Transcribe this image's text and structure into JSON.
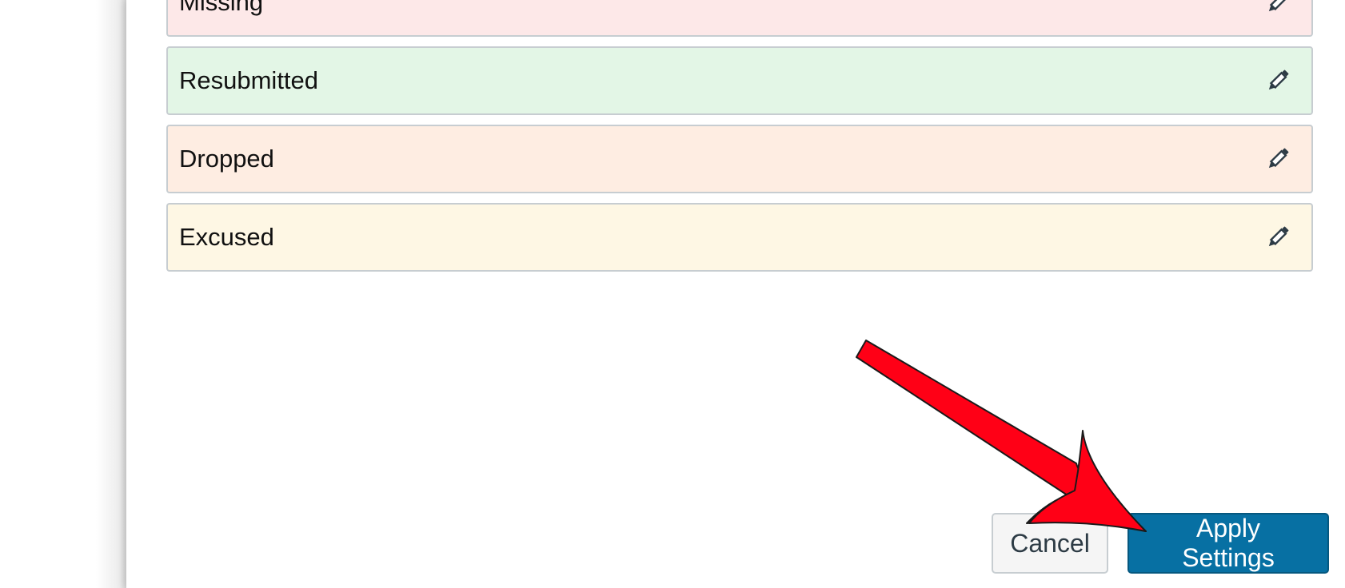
{
  "statuses": [
    {
      "label": "Missing",
      "color": "#fde8e8"
    },
    {
      "label": "Resubmitted",
      "color": "#e3f6e6"
    },
    {
      "label": "Dropped",
      "color": "#feede2"
    },
    {
      "label": "Excused",
      "color": "#fef7e4"
    }
  ],
  "edit_icon": "pencil-icon",
  "footer": {
    "cancel_label": "Cancel",
    "apply_label": "Apply Settings"
  },
  "colors": {
    "apply_button": "#0770a3",
    "annotation_arrow": "#ff0016"
  }
}
